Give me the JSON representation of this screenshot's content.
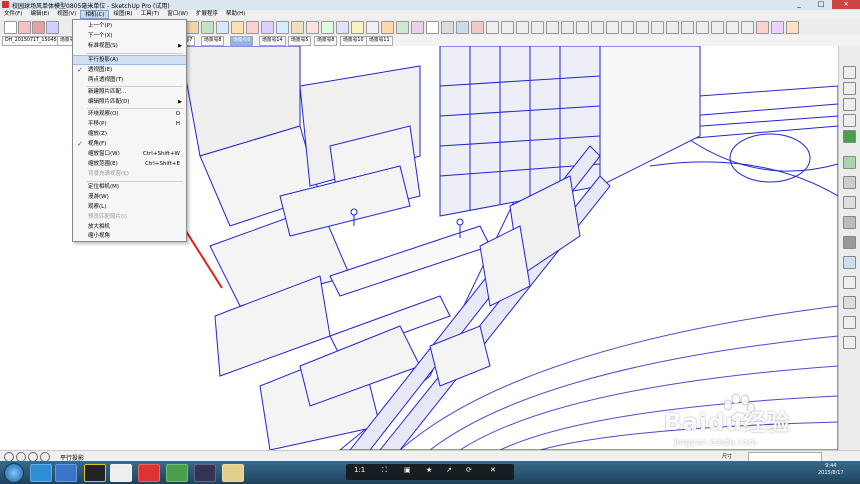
{
  "window": {
    "title": "校园球场风单体模型0805毫米单位 - SketchUp Pro (试用)",
    "controls": [
      "_",
      "□",
      "×"
    ]
  },
  "menubar": {
    "items": [
      "文件(F)",
      "编辑(E)",
      "视图(V)",
      "相机(C)",
      "绘图(R)",
      "工具(T)",
      "窗口(W)",
      "扩展程序",
      "帮助(H)"
    ],
    "active_index": 3
  },
  "scene_tabs": {
    "items": [
      "DH_2015071T_150458",
      "场景号1",
      "场景号7",
      "场景号8",
      "场景号9",
      "场景号1",
      "场景号14",
      "场景号5",
      "场景号6",
      "场景号8",
      "场景号9",
      "场景号10",
      "场景号11"
    ],
    "selected_index": 7
  },
  "camera_menu": {
    "items": [
      {
        "label": "上一个(P)",
        "shortcut": "",
        "checked": false,
        "disabled": false,
        "submenu": false,
        "highlight": false
      },
      {
        "label": "下一个(X)",
        "shortcut": "",
        "checked": false,
        "disabled": false,
        "submenu": false,
        "highlight": false
      },
      {
        "label": "标准视图(S)",
        "shortcut": "",
        "checked": false,
        "disabled": false,
        "submenu": true,
        "highlight": false
      },
      {
        "label": "平行投影(A)",
        "shortcut": "",
        "checked": false,
        "disabled": false,
        "submenu": false,
        "highlight": true
      },
      {
        "label": "透视图(E)",
        "shortcut": "",
        "checked": true,
        "disabled": false,
        "submenu": false,
        "highlight": false
      },
      {
        "label": "两点透视图(T)",
        "shortcut": "",
        "checked": false,
        "disabled": false,
        "submenu": false,
        "highlight": false
      },
      {
        "label": "新建照片匹配...",
        "shortcut": "",
        "checked": false,
        "disabled": false,
        "submenu": false,
        "highlight": false
      },
      {
        "label": "编辑照片匹配(D)",
        "shortcut": "",
        "checked": false,
        "disabled": false,
        "submenu": true,
        "highlight": false
      },
      {
        "label": "环绕观察(O)",
        "shortcut": "O",
        "checked": false,
        "disabled": false,
        "submenu": false,
        "highlight": false
      },
      {
        "label": "平移(P)",
        "shortcut": "H",
        "checked": false,
        "disabled": false,
        "submenu": false,
        "highlight": false
      },
      {
        "label": "缩放(Z)",
        "shortcut": "",
        "checked": false,
        "disabled": false,
        "submenu": false,
        "highlight": false
      },
      {
        "label": "视角(F)",
        "shortcut": "",
        "checked": true,
        "disabled": false,
        "submenu": false,
        "highlight": false
      },
      {
        "label": "缩放窗口(W)",
        "shortcut": "Ctrl+Shift+W",
        "checked": false,
        "disabled": false,
        "submenu": false,
        "highlight": false
      },
      {
        "label": "缩放范围(E)",
        "shortcut": "Ctrl+Shift+E",
        "checked": false,
        "disabled": false,
        "submenu": false,
        "highlight": false
      },
      {
        "label": "背景充满视窗(K)",
        "shortcut": "",
        "checked": false,
        "disabled": true,
        "submenu": false,
        "highlight": false
      },
      {
        "label": "定位相机(M)",
        "shortcut": "",
        "checked": false,
        "disabled": false,
        "submenu": false,
        "highlight": false
      },
      {
        "label": "漫游(W)",
        "shortcut": "",
        "checked": false,
        "disabled": false,
        "submenu": false,
        "highlight": false
      },
      {
        "label": "观察(L)",
        "shortcut": "",
        "checked": false,
        "disabled": false,
        "submenu": false,
        "highlight": false
      },
      {
        "label": "预览匹配照片(I)",
        "shortcut": "",
        "checked": false,
        "disabled": true,
        "submenu": false,
        "highlight": false
      },
      {
        "label": "放大相机",
        "shortcut": "",
        "checked": false,
        "disabled": false,
        "submenu": false,
        "highlight": false
      },
      {
        "label": "缩小视角",
        "shortcut": "",
        "checked": false,
        "disabled": false,
        "submenu": false,
        "highlight": false
      }
    ]
  },
  "status": {
    "text": "平行投影",
    "measurements_label": "尺寸"
  },
  "taskbar": {
    "media_ratio": "1:1",
    "tray_text": "",
    "time": "9:44",
    "date": "2015/8/17"
  },
  "watermark": {
    "brand": "Baidu经验",
    "url": "jingyan.baidu.com"
  },
  "colors": {
    "edge_blue": "#1f24d6",
    "arrow_red": "#e02020",
    "menu_highlight": "#cfe0f5",
    "selected_tab": "#8fb4e3"
  }
}
